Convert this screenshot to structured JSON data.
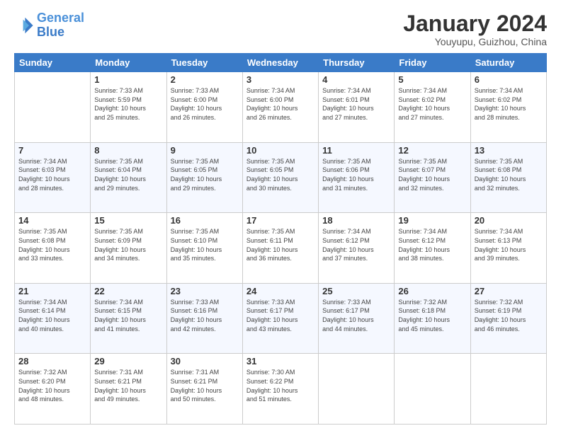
{
  "header": {
    "logo_line1": "General",
    "logo_line2": "Blue",
    "month": "January 2024",
    "location": "Youyupu, Guizhou, China"
  },
  "days_of_week": [
    "Sunday",
    "Monday",
    "Tuesday",
    "Wednesday",
    "Thursday",
    "Friday",
    "Saturday"
  ],
  "weeks": [
    [
      {
        "day": "",
        "info": ""
      },
      {
        "day": "1",
        "info": "Sunrise: 7:33 AM\nSunset: 5:59 PM\nDaylight: 10 hours\nand 25 minutes."
      },
      {
        "day": "2",
        "info": "Sunrise: 7:33 AM\nSunset: 6:00 PM\nDaylight: 10 hours\nand 26 minutes."
      },
      {
        "day": "3",
        "info": "Sunrise: 7:34 AM\nSunset: 6:00 PM\nDaylight: 10 hours\nand 26 minutes."
      },
      {
        "day": "4",
        "info": "Sunrise: 7:34 AM\nSunset: 6:01 PM\nDaylight: 10 hours\nand 27 minutes."
      },
      {
        "day": "5",
        "info": "Sunrise: 7:34 AM\nSunset: 6:02 PM\nDaylight: 10 hours\nand 27 minutes."
      },
      {
        "day": "6",
        "info": "Sunrise: 7:34 AM\nSunset: 6:02 PM\nDaylight: 10 hours\nand 28 minutes."
      }
    ],
    [
      {
        "day": "7",
        "info": "Sunrise: 7:34 AM\nSunset: 6:03 PM\nDaylight: 10 hours\nand 28 minutes."
      },
      {
        "day": "8",
        "info": "Sunrise: 7:35 AM\nSunset: 6:04 PM\nDaylight: 10 hours\nand 29 minutes."
      },
      {
        "day": "9",
        "info": "Sunrise: 7:35 AM\nSunset: 6:05 PM\nDaylight: 10 hours\nand 29 minutes."
      },
      {
        "day": "10",
        "info": "Sunrise: 7:35 AM\nSunset: 6:05 PM\nDaylight: 10 hours\nand 30 minutes."
      },
      {
        "day": "11",
        "info": "Sunrise: 7:35 AM\nSunset: 6:06 PM\nDaylight: 10 hours\nand 31 minutes."
      },
      {
        "day": "12",
        "info": "Sunrise: 7:35 AM\nSunset: 6:07 PM\nDaylight: 10 hours\nand 32 minutes."
      },
      {
        "day": "13",
        "info": "Sunrise: 7:35 AM\nSunset: 6:08 PM\nDaylight: 10 hours\nand 32 minutes."
      }
    ],
    [
      {
        "day": "14",
        "info": "Sunrise: 7:35 AM\nSunset: 6:08 PM\nDaylight: 10 hours\nand 33 minutes."
      },
      {
        "day": "15",
        "info": "Sunrise: 7:35 AM\nSunset: 6:09 PM\nDaylight: 10 hours\nand 34 minutes."
      },
      {
        "day": "16",
        "info": "Sunrise: 7:35 AM\nSunset: 6:10 PM\nDaylight: 10 hours\nand 35 minutes."
      },
      {
        "day": "17",
        "info": "Sunrise: 7:35 AM\nSunset: 6:11 PM\nDaylight: 10 hours\nand 36 minutes."
      },
      {
        "day": "18",
        "info": "Sunrise: 7:34 AM\nSunset: 6:12 PM\nDaylight: 10 hours\nand 37 minutes."
      },
      {
        "day": "19",
        "info": "Sunrise: 7:34 AM\nSunset: 6:12 PM\nDaylight: 10 hours\nand 38 minutes."
      },
      {
        "day": "20",
        "info": "Sunrise: 7:34 AM\nSunset: 6:13 PM\nDaylight: 10 hours\nand 39 minutes."
      }
    ],
    [
      {
        "day": "21",
        "info": "Sunrise: 7:34 AM\nSunset: 6:14 PM\nDaylight: 10 hours\nand 40 minutes."
      },
      {
        "day": "22",
        "info": "Sunrise: 7:34 AM\nSunset: 6:15 PM\nDaylight: 10 hours\nand 41 minutes."
      },
      {
        "day": "23",
        "info": "Sunrise: 7:33 AM\nSunset: 6:16 PM\nDaylight: 10 hours\nand 42 minutes."
      },
      {
        "day": "24",
        "info": "Sunrise: 7:33 AM\nSunset: 6:17 PM\nDaylight: 10 hours\nand 43 minutes."
      },
      {
        "day": "25",
        "info": "Sunrise: 7:33 AM\nSunset: 6:17 PM\nDaylight: 10 hours\nand 44 minutes."
      },
      {
        "day": "26",
        "info": "Sunrise: 7:32 AM\nSunset: 6:18 PM\nDaylight: 10 hours\nand 45 minutes."
      },
      {
        "day": "27",
        "info": "Sunrise: 7:32 AM\nSunset: 6:19 PM\nDaylight: 10 hours\nand 46 minutes."
      }
    ],
    [
      {
        "day": "28",
        "info": "Sunrise: 7:32 AM\nSunset: 6:20 PM\nDaylight: 10 hours\nand 48 minutes."
      },
      {
        "day": "29",
        "info": "Sunrise: 7:31 AM\nSunset: 6:21 PM\nDaylight: 10 hours\nand 49 minutes."
      },
      {
        "day": "30",
        "info": "Sunrise: 7:31 AM\nSunset: 6:21 PM\nDaylight: 10 hours\nand 50 minutes."
      },
      {
        "day": "31",
        "info": "Sunrise: 7:30 AM\nSunset: 6:22 PM\nDaylight: 10 hours\nand 51 minutes."
      },
      {
        "day": "",
        "info": ""
      },
      {
        "day": "",
        "info": ""
      },
      {
        "day": "",
        "info": ""
      }
    ]
  ]
}
